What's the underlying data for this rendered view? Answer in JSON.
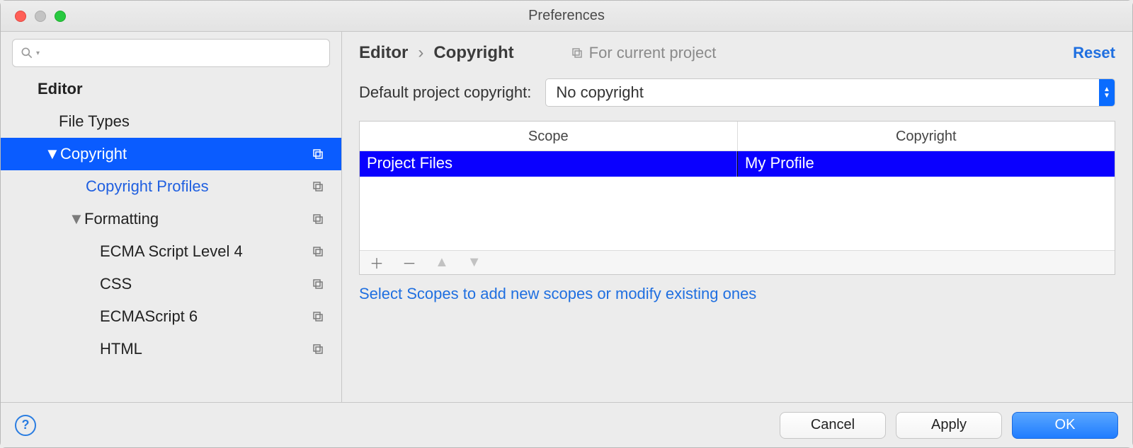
{
  "window": {
    "title": "Preferences"
  },
  "search": {
    "placeholder": ""
  },
  "sidebar": {
    "items": [
      {
        "label": "Editor"
      },
      {
        "label": "File Types"
      },
      {
        "label": "Copyright"
      },
      {
        "label": "Copyright Profiles"
      },
      {
        "label": "Formatting"
      },
      {
        "label": "ECMA Script Level 4"
      },
      {
        "label": "CSS"
      },
      {
        "label": "ECMAScript 6"
      },
      {
        "label": "HTML"
      }
    ]
  },
  "breadcrumb": {
    "a": "Editor",
    "sep": "›",
    "b": "Copyright"
  },
  "scope_hint": "For current project",
  "reset": "Reset",
  "form": {
    "label": "Default project copyright:",
    "selected": "No copyright"
  },
  "table": {
    "headers": [
      "Scope",
      "Copyright"
    ],
    "rows": [
      {
        "scope": "Project Files",
        "copyright": "My Profile"
      }
    ]
  },
  "toolbar": {
    "add": "＋",
    "remove": "－",
    "up": "▲",
    "down": "▼"
  },
  "helper": "Select Scopes to add new scopes or modify existing ones",
  "buttons": {
    "cancel": "Cancel",
    "apply": "Apply",
    "ok": "OK"
  },
  "help": "?"
}
